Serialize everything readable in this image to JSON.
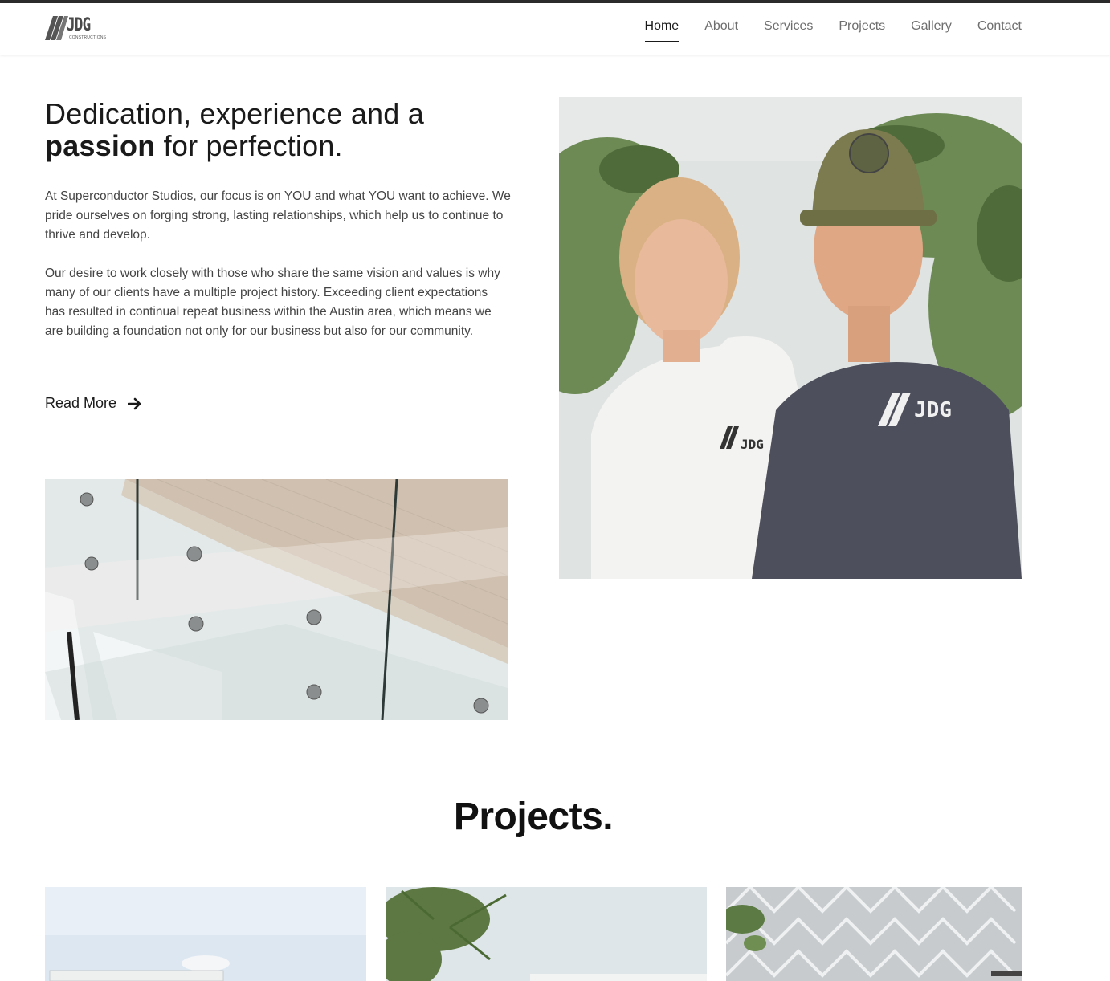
{
  "brand": {
    "logo_text": "JDG",
    "logo_subtext": "CONSTRUCTIONS"
  },
  "nav": {
    "items": [
      {
        "label": "Home",
        "active": true
      },
      {
        "label": "About",
        "active": false
      },
      {
        "label": "Services",
        "active": false
      },
      {
        "label": "Projects",
        "active": false
      },
      {
        "label": "Gallery",
        "active": false
      },
      {
        "label": "Contact",
        "active": false
      }
    ]
  },
  "hero": {
    "headline_line1": "Dedication, experience and a",
    "headline_bold": "passion",
    "headline_rest": " for perfection.",
    "paragraph1": "At Superconductor Studios, our focus is on YOU and what YOU want to achieve. We pride ourselves on forging strong, lasting relationships, which help us to continue to thrive and develop.",
    "paragraph2": "Our desire to work closely with those who share the same vision and values is why many of our clients have a multiple project history. Exceeding client expectations has resulted in continual repeat business within the Austin area, which means we are building a foundation not only for our business but also for our community.",
    "read_more_label": "Read More",
    "read_more_icon": "arrow-right-icon"
  },
  "projects": {
    "title": "Projects."
  },
  "colors": {
    "accent": "#1a1a1a",
    "muted_text": "#6e6e6e",
    "body_text": "#444444",
    "topbar": "#2b2b2b"
  }
}
